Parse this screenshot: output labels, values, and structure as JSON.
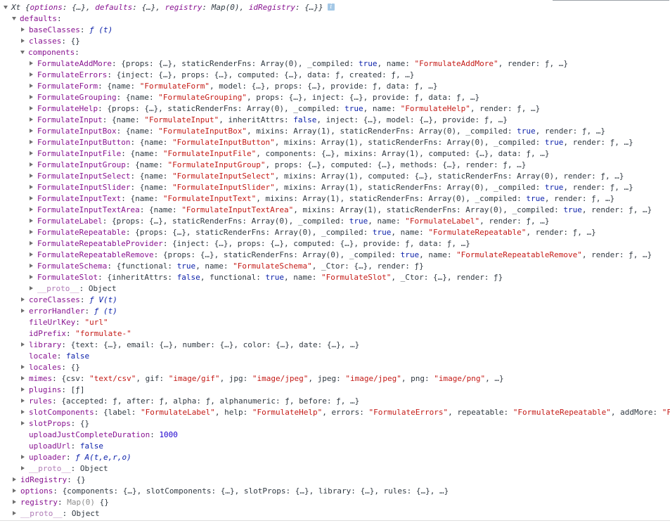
{
  "rows": [
    {
      "indent": 0,
      "tri": "open",
      "summary": true,
      "segs": [
        {
          "t": "Xt {",
          "c": "ital"
        },
        {
          "t": "options",
          "c": "ital key"
        },
        {
          "t": ": {…}, ",
          "c": "ital"
        },
        {
          "t": "defaults",
          "c": "ital key"
        },
        {
          "t": ": {…}, ",
          "c": "ital"
        },
        {
          "t": "registry",
          "c": "ital key"
        },
        {
          "t": ": Map(0), ",
          "c": "ital"
        },
        {
          "t": "idRegistry",
          "c": "ital key"
        },
        {
          "t": ": {…}}",
          "c": "ital"
        }
      ],
      "badge": "i"
    },
    {
      "indent": 1,
      "tri": "open",
      "segs": [
        {
          "t": "defaults",
          "c": "key"
        },
        {
          "t": ":",
          "c": "p"
        }
      ]
    },
    {
      "indent": 2,
      "tri": "closed",
      "segs": [
        {
          "t": "baseClasses",
          "c": "key"
        },
        {
          "t": ": ",
          "c": "p"
        },
        {
          "t": "ƒ (t)",
          "c": "fn"
        }
      ]
    },
    {
      "indent": 2,
      "tri": "closed",
      "segs": [
        {
          "t": "classes",
          "c": "key"
        },
        {
          "t": ": {}",
          "c": "p"
        }
      ]
    },
    {
      "indent": 2,
      "tri": "open",
      "segs": [
        {
          "t": "components",
          "c": "key"
        },
        {
          "t": ":",
          "c": "p"
        }
      ]
    },
    {
      "indent": 3,
      "tri": "closed",
      "segs": [
        {
          "t": "FormulateAddMore",
          "c": "key"
        },
        {
          "t": ": {props: {…}, staticRenderFns: Array(0), _compiled: ",
          "c": "p"
        },
        {
          "t": "true",
          "c": "kw"
        },
        {
          "t": ", name: ",
          "c": "p"
        },
        {
          "t": "\"FormulateAddMore\"",
          "c": "str"
        },
        {
          "t": ", render: ƒ, …}",
          "c": "p"
        }
      ]
    },
    {
      "indent": 3,
      "tri": "closed",
      "segs": [
        {
          "t": "FormulateErrors",
          "c": "key"
        },
        {
          "t": ": {inject: {…}, props: {…}, computed: {…}, data: ƒ, created: ƒ, …}",
          "c": "p"
        }
      ]
    },
    {
      "indent": 3,
      "tri": "closed",
      "segs": [
        {
          "t": "FormulateForm",
          "c": "key"
        },
        {
          "t": ": {name: ",
          "c": "p"
        },
        {
          "t": "\"FormulateForm\"",
          "c": "str"
        },
        {
          "t": ", model: {…}, props: {…}, provide: ƒ, data: ƒ, …}",
          "c": "p"
        }
      ]
    },
    {
      "indent": 3,
      "tri": "closed",
      "segs": [
        {
          "t": "FormulateGrouping",
          "c": "key"
        },
        {
          "t": ": {name: ",
          "c": "p"
        },
        {
          "t": "\"FormulateGrouping\"",
          "c": "str"
        },
        {
          "t": ", props: {…}, inject: {…}, provide: ƒ, data: ƒ, …}",
          "c": "p"
        }
      ]
    },
    {
      "indent": 3,
      "tri": "closed",
      "segs": [
        {
          "t": "FormulateHelp",
          "c": "key"
        },
        {
          "t": ": {props: {…}, staticRenderFns: Array(0), _compiled: ",
          "c": "p"
        },
        {
          "t": "true",
          "c": "kw"
        },
        {
          "t": ", name: ",
          "c": "p"
        },
        {
          "t": "\"FormulateHelp\"",
          "c": "str"
        },
        {
          "t": ", render: ƒ, …}",
          "c": "p"
        }
      ]
    },
    {
      "indent": 3,
      "tri": "closed",
      "segs": [
        {
          "t": "FormulateInput",
          "c": "key"
        },
        {
          "t": ": {name: ",
          "c": "p"
        },
        {
          "t": "\"FormulateInput\"",
          "c": "str"
        },
        {
          "t": ", inheritAttrs: ",
          "c": "p"
        },
        {
          "t": "false",
          "c": "kw"
        },
        {
          "t": ", inject: {…}, model: {…}, provide: ƒ, …}",
          "c": "p"
        }
      ]
    },
    {
      "indent": 3,
      "tri": "closed",
      "segs": [
        {
          "t": "FormulateInputBox",
          "c": "key"
        },
        {
          "t": ": {name: ",
          "c": "p"
        },
        {
          "t": "\"FormulateInputBox\"",
          "c": "str"
        },
        {
          "t": ", mixins: Array(1), staticRenderFns: Array(0), _compiled: ",
          "c": "p"
        },
        {
          "t": "true",
          "c": "kw"
        },
        {
          "t": ", render: ƒ, …}",
          "c": "p"
        }
      ]
    },
    {
      "indent": 3,
      "tri": "closed",
      "segs": [
        {
          "t": "FormulateInputButton",
          "c": "key"
        },
        {
          "t": ": {name: ",
          "c": "p"
        },
        {
          "t": "\"FormulateInputButton\"",
          "c": "str"
        },
        {
          "t": ", mixins: Array(1), staticRenderFns: Array(0), _compiled: ",
          "c": "p"
        },
        {
          "t": "true",
          "c": "kw"
        },
        {
          "t": ", render: ƒ, …}",
          "c": "p"
        }
      ]
    },
    {
      "indent": 3,
      "tri": "closed",
      "segs": [
        {
          "t": "FormulateInputFile",
          "c": "key"
        },
        {
          "t": ": {name: ",
          "c": "p"
        },
        {
          "t": "\"FormulateInputFile\"",
          "c": "str"
        },
        {
          "t": ", components: {…}, mixins: Array(1), computed: {…}, data: ƒ, …}",
          "c": "p"
        }
      ]
    },
    {
      "indent": 3,
      "tri": "closed",
      "segs": [
        {
          "t": "FormulateInputGroup",
          "c": "key"
        },
        {
          "t": ": {name: ",
          "c": "p"
        },
        {
          "t": "\"FormulateInputGroup\"",
          "c": "str"
        },
        {
          "t": ", props: {…}, computed: {…}, methods: {…}, render: ƒ, …}",
          "c": "p"
        }
      ]
    },
    {
      "indent": 3,
      "tri": "closed",
      "segs": [
        {
          "t": "FormulateInputSelect",
          "c": "key"
        },
        {
          "t": ": {name: ",
          "c": "p"
        },
        {
          "t": "\"FormulateInputSelect\"",
          "c": "str"
        },
        {
          "t": ", mixins: Array(1), computed: {…}, staticRenderFns: Array(0), render: ƒ, …}",
          "c": "p"
        }
      ]
    },
    {
      "indent": 3,
      "tri": "closed",
      "segs": [
        {
          "t": "FormulateInputSlider",
          "c": "key"
        },
        {
          "t": ": {name: ",
          "c": "p"
        },
        {
          "t": "\"FormulateInputSlider\"",
          "c": "str"
        },
        {
          "t": ", mixins: Array(1), staticRenderFns: Array(0), _compiled: ",
          "c": "p"
        },
        {
          "t": "true",
          "c": "kw"
        },
        {
          "t": ", render: ƒ, …}",
          "c": "p"
        }
      ]
    },
    {
      "indent": 3,
      "tri": "closed",
      "segs": [
        {
          "t": "FormulateInputText",
          "c": "key"
        },
        {
          "t": ": {name: ",
          "c": "p"
        },
        {
          "t": "\"FormulateInputText\"",
          "c": "str"
        },
        {
          "t": ", mixins: Array(1), staticRenderFns: Array(0), _compiled: ",
          "c": "p"
        },
        {
          "t": "true",
          "c": "kw"
        },
        {
          "t": ", render: ƒ, …}",
          "c": "p"
        }
      ]
    },
    {
      "indent": 3,
      "tri": "closed",
      "segs": [
        {
          "t": "FormulateInputTextArea",
          "c": "key"
        },
        {
          "t": ": {name: ",
          "c": "p"
        },
        {
          "t": "\"FormulateInputTextArea\"",
          "c": "str"
        },
        {
          "t": ", mixins: Array(1), staticRenderFns: Array(0), _compiled: ",
          "c": "p"
        },
        {
          "t": "true",
          "c": "kw"
        },
        {
          "t": ", render: ƒ, …}",
          "c": "p"
        }
      ]
    },
    {
      "indent": 3,
      "tri": "closed",
      "segs": [
        {
          "t": "FormulateLabel",
          "c": "key"
        },
        {
          "t": ": {props: {…}, staticRenderFns: Array(0), _compiled: ",
          "c": "p"
        },
        {
          "t": "true",
          "c": "kw"
        },
        {
          "t": ", name: ",
          "c": "p"
        },
        {
          "t": "\"FormulateLabel\"",
          "c": "str"
        },
        {
          "t": ", render: ƒ, …}",
          "c": "p"
        }
      ]
    },
    {
      "indent": 3,
      "tri": "closed",
      "segs": [
        {
          "t": "FormulateRepeatable",
          "c": "key"
        },
        {
          "t": ": {props: {…}, staticRenderFns: Array(0), _compiled: ",
          "c": "p"
        },
        {
          "t": "true",
          "c": "kw"
        },
        {
          "t": ", name: ",
          "c": "p"
        },
        {
          "t": "\"FormulateRepeatable\"",
          "c": "str"
        },
        {
          "t": ", render: ƒ, …}",
          "c": "p"
        }
      ]
    },
    {
      "indent": 3,
      "tri": "closed",
      "segs": [
        {
          "t": "FormulateRepeatableProvider",
          "c": "key"
        },
        {
          "t": ": {inject: {…}, props: {…}, computed: {…}, provide: ƒ, data: ƒ, …}",
          "c": "p"
        }
      ]
    },
    {
      "indent": 3,
      "tri": "closed",
      "segs": [
        {
          "t": "FormulateRepeatableRemove",
          "c": "key"
        },
        {
          "t": ": {props: {…}, staticRenderFns: Array(0), _compiled: ",
          "c": "p"
        },
        {
          "t": "true",
          "c": "kw"
        },
        {
          "t": ", name: ",
          "c": "p"
        },
        {
          "t": "\"FormulateRepeatableRemove\"",
          "c": "str"
        },
        {
          "t": ", render: ƒ, …}",
          "c": "p"
        }
      ]
    },
    {
      "indent": 3,
      "tri": "closed",
      "segs": [
        {
          "t": "FormulateSchema",
          "c": "key"
        },
        {
          "t": ": {functional: ",
          "c": "p"
        },
        {
          "t": "true",
          "c": "kw"
        },
        {
          "t": ", name: ",
          "c": "p"
        },
        {
          "t": "\"FormulateSchema\"",
          "c": "str"
        },
        {
          "t": ", _Ctor: {…}, render: ƒ}",
          "c": "p"
        }
      ]
    },
    {
      "indent": 3,
      "tri": "closed",
      "segs": [
        {
          "t": "FormulateSlot",
          "c": "key"
        },
        {
          "t": ": {inheritAttrs: ",
          "c": "p"
        },
        {
          "t": "false",
          "c": "kw"
        },
        {
          "t": ", functional: ",
          "c": "p"
        },
        {
          "t": "true",
          "c": "kw"
        },
        {
          "t": ", name: ",
          "c": "p"
        },
        {
          "t": "\"FormulateSlot\"",
          "c": "str"
        },
        {
          "t": ", _Ctor: {…}, render: ƒ}",
          "c": "p"
        }
      ]
    },
    {
      "indent": 3,
      "tri": "closed",
      "segs": [
        {
          "t": "__proto__",
          "c": "key proto"
        },
        {
          "t": ": Object",
          "c": "p"
        }
      ]
    },
    {
      "indent": 2,
      "tri": "closed",
      "segs": [
        {
          "t": "coreClasses",
          "c": "key"
        },
        {
          "t": ": ",
          "c": "p"
        },
        {
          "t": "ƒ V(t)",
          "c": "fn"
        }
      ]
    },
    {
      "indent": 2,
      "tri": "closed",
      "segs": [
        {
          "t": "errorHandler",
          "c": "key"
        },
        {
          "t": ": ",
          "c": "p"
        },
        {
          "t": "ƒ (t)",
          "c": "fn"
        }
      ]
    },
    {
      "indent": 2,
      "tri": "none",
      "segs": [
        {
          "t": "fileUrlKey",
          "c": "key"
        },
        {
          "t": ": ",
          "c": "p"
        },
        {
          "t": "\"url\"",
          "c": "str"
        }
      ]
    },
    {
      "indent": 2,
      "tri": "none",
      "segs": [
        {
          "t": "idPrefix",
          "c": "key"
        },
        {
          "t": ": ",
          "c": "p"
        },
        {
          "t": "\"formulate-\"",
          "c": "str"
        }
      ]
    },
    {
      "indent": 2,
      "tri": "closed",
      "segs": [
        {
          "t": "library",
          "c": "key"
        },
        {
          "t": ": {text: {…}, email: {…}, number: {…}, color: {…}, date: {…}, …}",
          "c": "p"
        }
      ]
    },
    {
      "indent": 2,
      "tri": "none",
      "segs": [
        {
          "t": "locale",
          "c": "key"
        },
        {
          "t": ": ",
          "c": "p"
        },
        {
          "t": "false",
          "c": "kw"
        }
      ]
    },
    {
      "indent": 2,
      "tri": "closed",
      "segs": [
        {
          "t": "locales",
          "c": "key"
        },
        {
          "t": ": {}",
          "c": "p"
        }
      ]
    },
    {
      "indent": 2,
      "tri": "closed",
      "segs": [
        {
          "t": "mimes",
          "c": "key"
        },
        {
          "t": ": {csv: ",
          "c": "p"
        },
        {
          "t": "\"text/csv\"",
          "c": "str"
        },
        {
          "t": ", gif: ",
          "c": "p"
        },
        {
          "t": "\"image/gif\"",
          "c": "str"
        },
        {
          "t": ", jpg: ",
          "c": "p"
        },
        {
          "t": "\"image/jpeg\"",
          "c": "str"
        },
        {
          "t": ", jpeg: ",
          "c": "p"
        },
        {
          "t": "\"image/jpeg\"",
          "c": "str"
        },
        {
          "t": ", png: ",
          "c": "p"
        },
        {
          "t": "\"image/png\"",
          "c": "str"
        },
        {
          "t": ", …}",
          "c": "p"
        }
      ]
    },
    {
      "indent": 2,
      "tri": "closed",
      "segs": [
        {
          "t": "plugins",
          "c": "key"
        },
        {
          "t": ": [ƒ]",
          "c": "p"
        }
      ]
    },
    {
      "indent": 2,
      "tri": "closed",
      "segs": [
        {
          "t": "rules",
          "c": "key"
        },
        {
          "t": ": {accepted: ƒ, after: ƒ, alpha: ƒ, alphanumeric: ƒ, before: ƒ, …}",
          "c": "p"
        }
      ]
    },
    {
      "indent": 2,
      "tri": "closed",
      "segs": [
        {
          "t": "slotComponents",
          "c": "key"
        },
        {
          "t": ": {label: ",
          "c": "p"
        },
        {
          "t": "\"FormulateLabel\"",
          "c": "str"
        },
        {
          "t": ", help: ",
          "c": "p"
        },
        {
          "t": "\"FormulateHelp\"",
          "c": "str"
        },
        {
          "t": ", errors: ",
          "c": "p"
        },
        {
          "t": "\"FormulateErrors\"",
          "c": "str"
        },
        {
          "t": ", repeatable: ",
          "c": "p"
        },
        {
          "t": "\"FormulateRepeatable\"",
          "c": "str"
        },
        {
          "t": ", addMore: ",
          "c": "p"
        },
        {
          "t": "\"F",
          "c": "str"
        }
      ]
    },
    {
      "indent": 2,
      "tri": "closed",
      "segs": [
        {
          "t": "slotProps",
          "c": "key"
        },
        {
          "t": ": {}",
          "c": "p"
        }
      ]
    },
    {
      "indent": 2,
      "tri": "none",
      "segs": [
        {
          "t": "uploadJustCompleteDuration",
          "c": "key"
        },
        {
          "t": ": ",
          "c": "p"
        },
        {
          "t": "1000",
          "c": "num"
        }
      ]
    },
    {
      "indent": 2,
      "tri": "none",
      "segs": [
        {
          "t": "uploadUrl",
          "c": "key"
        },
        {
          "t": ": ",
          "c": "p"
        },
        {
          "t": "false",
          "c": "kw"
        }
      ]
    },
    {
      "indent": 2,
      "tri": "closed",
      "segs": [
        {
          "t": "uploader",
          "c": "key"
        },
        {
          "t": ": ",
          "c": "p"
        },
        {
          "t": "ƒ A(t,e,r,o)",
          "c": "fn"
        }
      ]
    },
    {
      "indent": 2,
      "tri": "closed",
      "segs": [
        {
          "t": "__proto__",
          "c": "key proto"
        },
        {
          "t": ": Object",
          "c": "p"
        }
      ]
    },
    {
      "indent": 1,
      "tri": "closed",
      "segs": [
        {
          "t": "idRegistry",
          "c": "key"
        },
        {
          "t": ": {}",
          "c": "p"
        }
      ]
    },
    {
      "indent": 1,
      "tri": "closed",
      "segs": [
        {
          "t": "options",
          "c": "key"
        },
        {
          "t": ": {components: {…}, slotComponents: {…}, slotProps: {…}, library: {…}, rules: {…}, …}",
          "c": "p"
        }
      ]
    },
    {
      "indent": 1,
      "tri": "closed",
      "segs": [
        {
          "t": "registry",
          "c": "key"
        },
        {
          "t": ": ",
          "c": "p"
        },
        {
          "t": "Map(0)",
          "c": "dim"
        },
        {
          "t": " {}",
          "c": "p"
        }
      ]
    },
    {
      "indent": 1,
      "tri": "closed",
      "segs": [
        {
          "t": "__proto__",
          "c": "key proto"
        },
        {
          "t": ": Object",
          "c": "p"
        }
      ]
    }
  ]
}
